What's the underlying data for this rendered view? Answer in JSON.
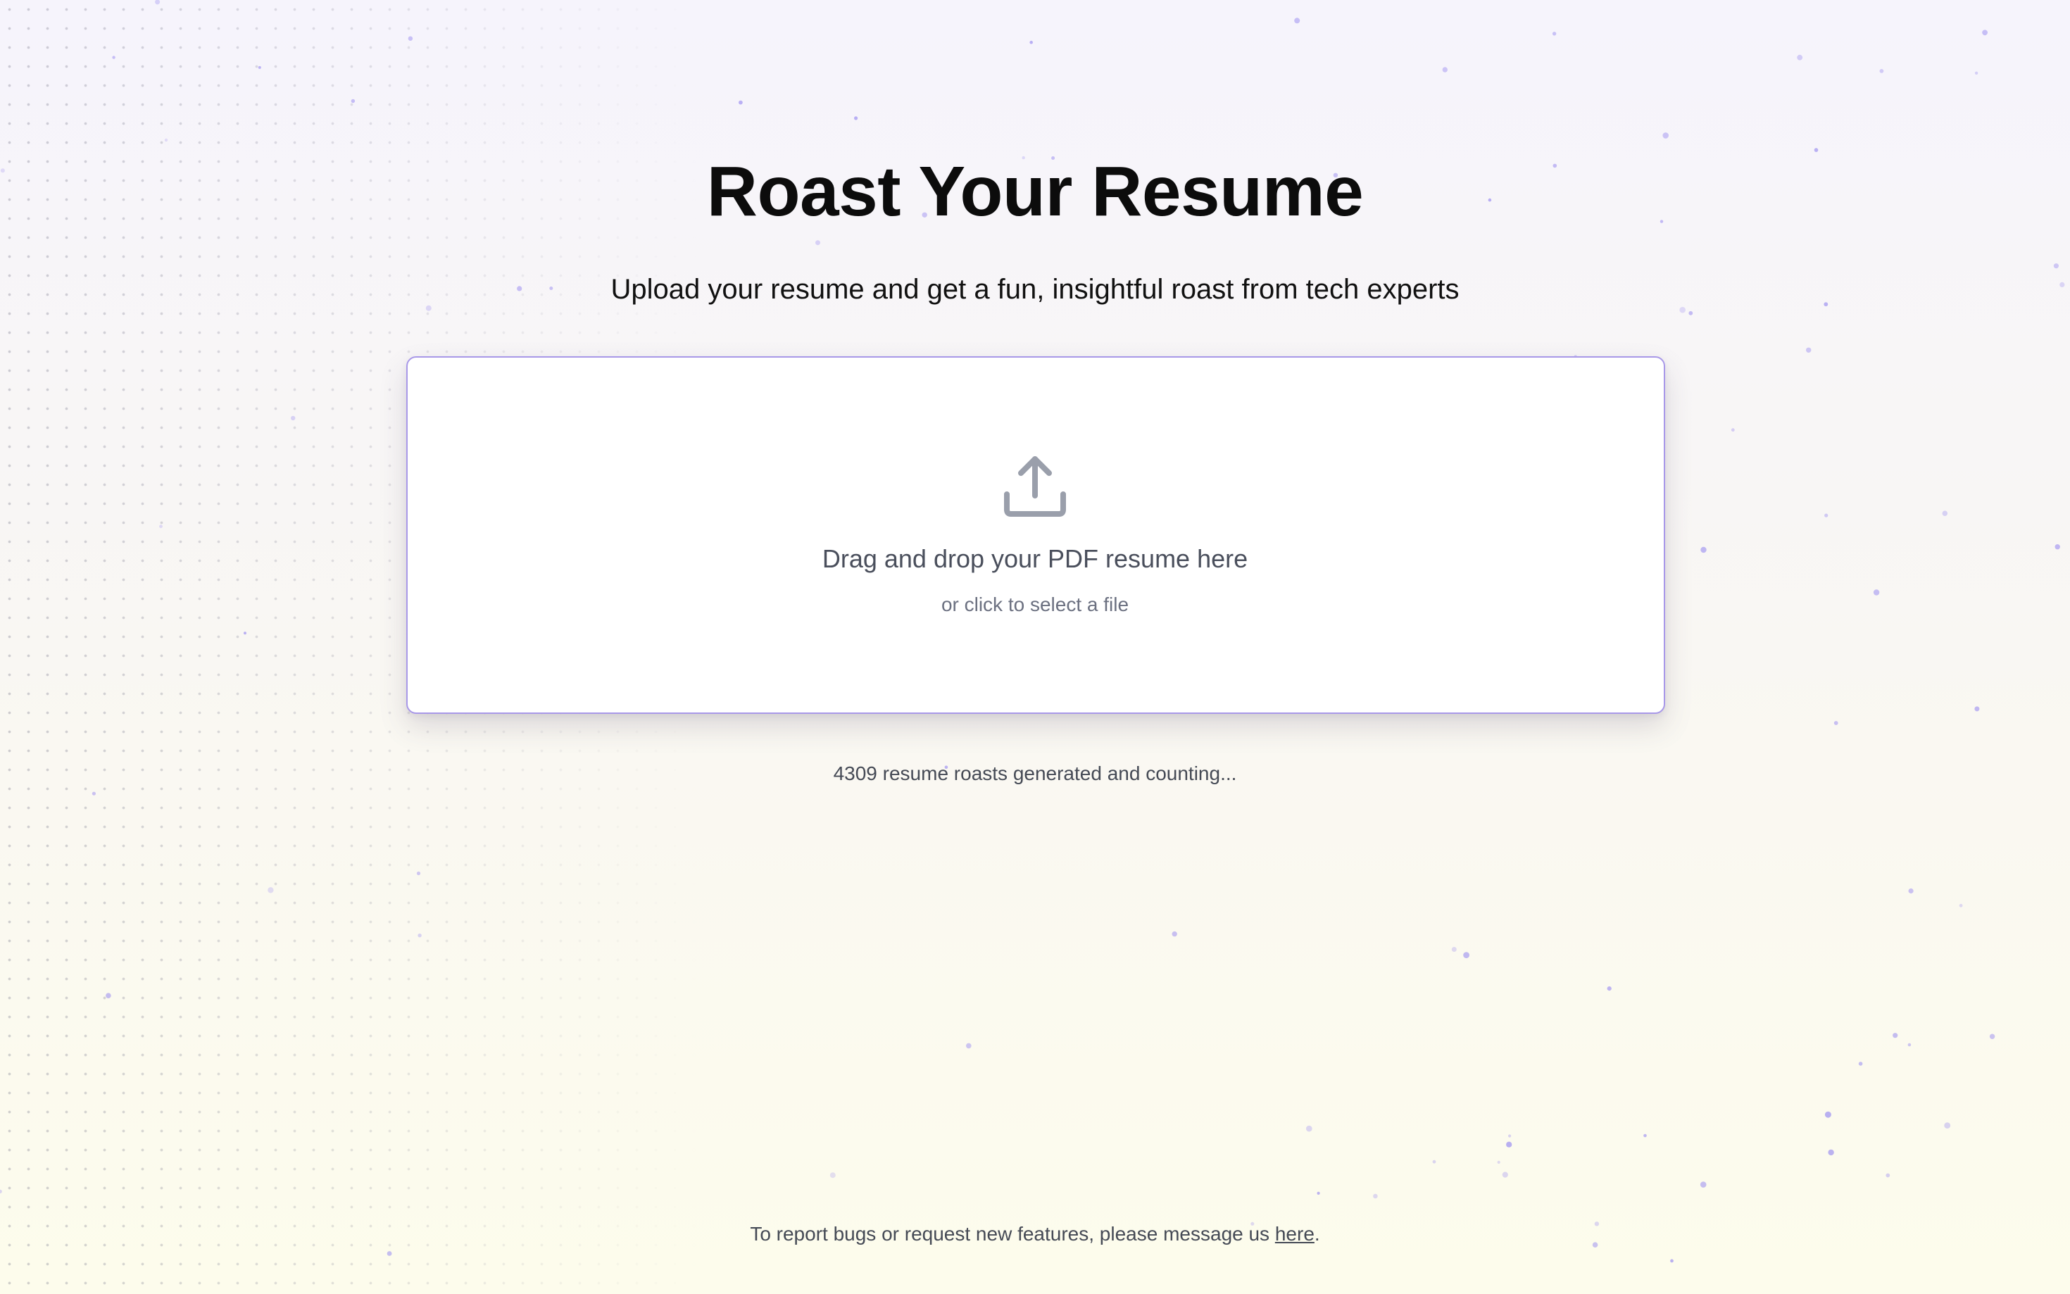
{
  "page": {
    "title": "Roast Your Resume",
    "subtitle": "Upload your resume and get a fun, insightful roast from tech experts"
  },
  "dropzone": {
    "icon": "upload-icon",
    "main_text": "Drag and drop your PDF resume here",
    "sub_text": "or click to select a file",
    "border_color": "#a898e8"
  },
  "stats": {
    "counter_text": "4309 resume roasts generated and counting..."
  },
  "footer": {
    "text_before": "To report bugs or request new features, please message us ",
    "link_text": "here",
    "text_after": "."
  },
  "colors": {
    "title": "#0c0c0c",
    "muted_text": "#4a4f5c",
    "sparkle": "#9a8cf0"
  }
}
